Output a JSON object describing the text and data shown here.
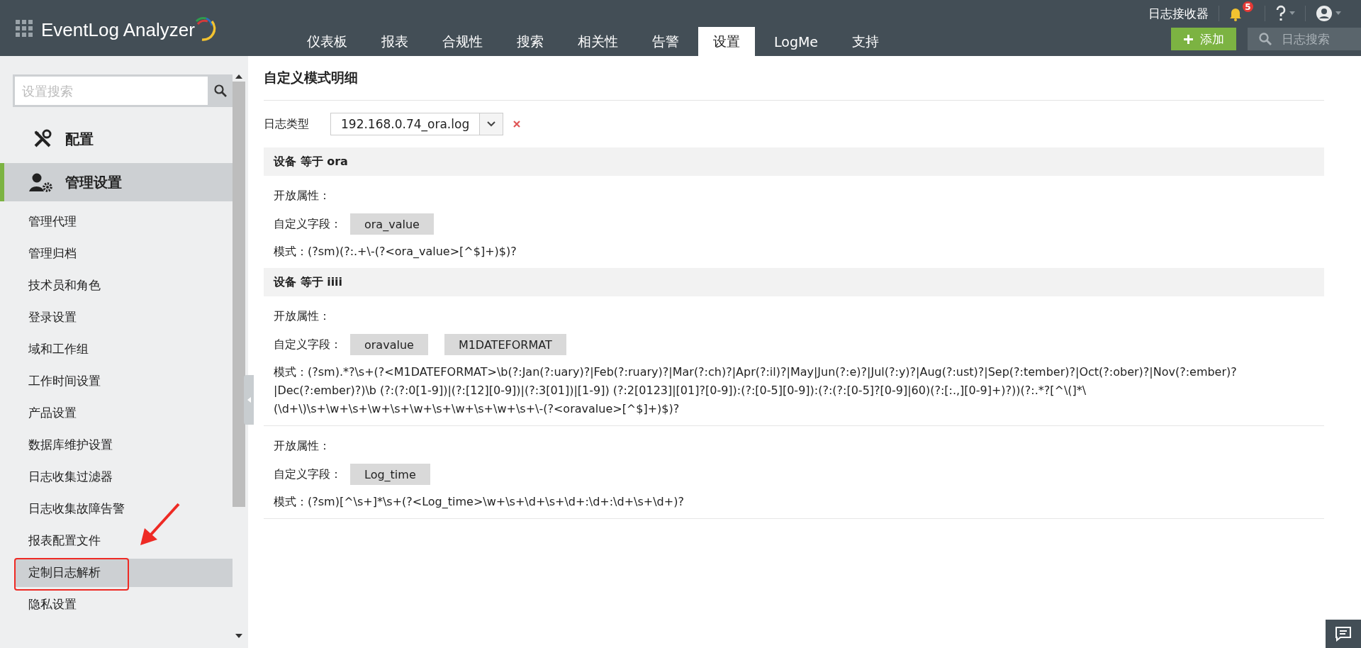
{
  "header": {
    "logo": "EventLog Analyzer",
    "tabs": [
      {
        "label": "仪表板",
        "selected": false
      },
      {
        "label": "报表",
        "selected": false
      },
      {
        "label": "合规性",
        "selected": false
      },
      {
        "label": "搜索",
        "selected": false
      },
      {
        "label": "相关性",
        "selected": false
      },
      {
        "label": "告警",
        "selected": false
      },
      {
        "label": "设置",
        "selected": true
      },
      {
        "label": "LogMe",
        "selected": false
      },
      {
        "label": "支持",
        "selected": false
      }
    ],
    "receiver_link": "日志接收器",
    "notification_count": "5",
    "add_button": "添加",
    "search": {
      "placeholder": "日志搜索"
    }
  },
  "sidebar": {
    "search": {
      "placeholder": "设置搜索"
    },
    "sections": [
      {
        "label": "配置",
        "kind": "tools",
        "selected": false
      },
      {
        "label": "管理设置",
        "kind": "admin",
        "selected": true
      }
    ],
    "items": [
      {
        "label": "管理代理",
        "selected": false
      },
      {
        "label": "管理归档",
        "selected": false
      },
      {
        "label": "技术员和角色",
        "selected": false
      },
      {
        "label": "登录设置",
        "selected": false
      },
      {
        "label": "域和工作组",
        "selected": false
      },
      {
        "label": "工作时间设置",
        "selected": false
      },
      {
        "label": "产品设置",
        "selected": false
      },
      {
        "label": "数据库维护设置",
        "selected": false
      },
      {
        "label": "日志收集过滤器",
        "selected": false
      },
      {
        "label": "日志收集故障告警",
        "selected": false
      },
      {
        "label": "报表配置文件",
        "selected": false
      },
      {
        "label": "定制日志解析",
        "selected": true
      },
      {
        "label": "隐私设置",
        "selected": false
      }
    ]
  },
  "content": {
    "title": "自定义模式明细",
    "log_type": {
      "label": "日志类型",
      "value": "192.168.0.74_ora.log"
    },
    "groups": [
      {
        "header": "设备 等于 ora",
        "rules": [
          {
            "open_attributes": "开放属性：",
            "fields_label": "自定义字段：",
            "fields": [
              "ora_value"
            ],
            "pattern": "模式：(?sm)(?:.+\\-(?<ora_value>[^$]+)$)?"
          }
        ]
      },
      {
        "header": "设备 等于 iiii",
        "rules": [
          {
            "open_attributes": "开放属性：",
            "fields_label": "自定义字段：",
            "fields": [
              "oravalue",
              "M1DATEFORMAT"
            ],
            "pattern": "模式：(?sm).*?\\s+(?<M1DATEFORMAT>\\b(?:Jan(?:uary)?|Feb(?:ruary)?|Mar(?:ch)?|Apr(?:il)?|May|Jun(?:e)?|Jul(?:y)?|Aug(?:ust)?|Sep(?:tember)?|Oct(?:ober)?|Nov(?:ember)?|Dec(?:ember)?)\\b (?:(?:0[1-9])|(?:[12][0-9])|(?:3[01])|[1-9]) (?:2[0123]|[01]?[0-9]):(?:[0-5][0-9]):(?:(?:[0-5]?[0-9]|60)(?:[:.,][0-9]+)?))(?:.*?[^\\(]*\\(\\d+\\)\\s+\\w+\\s+\\w+\\s+\\w+\\s+\\w+\\s+\\w+\\s+\\-(?<oravalue>[^$]+)$)?"
          },
          {
            "open_attributes": "开放属性：",
            "fields_label": "自定义字段：",
            "fields": [
              "Log_time"
            ],
            "pattern": "模式：(?sm)[^\\s+]*\\s+(?<Log_time>\\w+\\s+\\d+\\s+\\d+:\\d+:\\d+\\s+\\d+)?"
          }
        ]
      }
    ]
  }
}
